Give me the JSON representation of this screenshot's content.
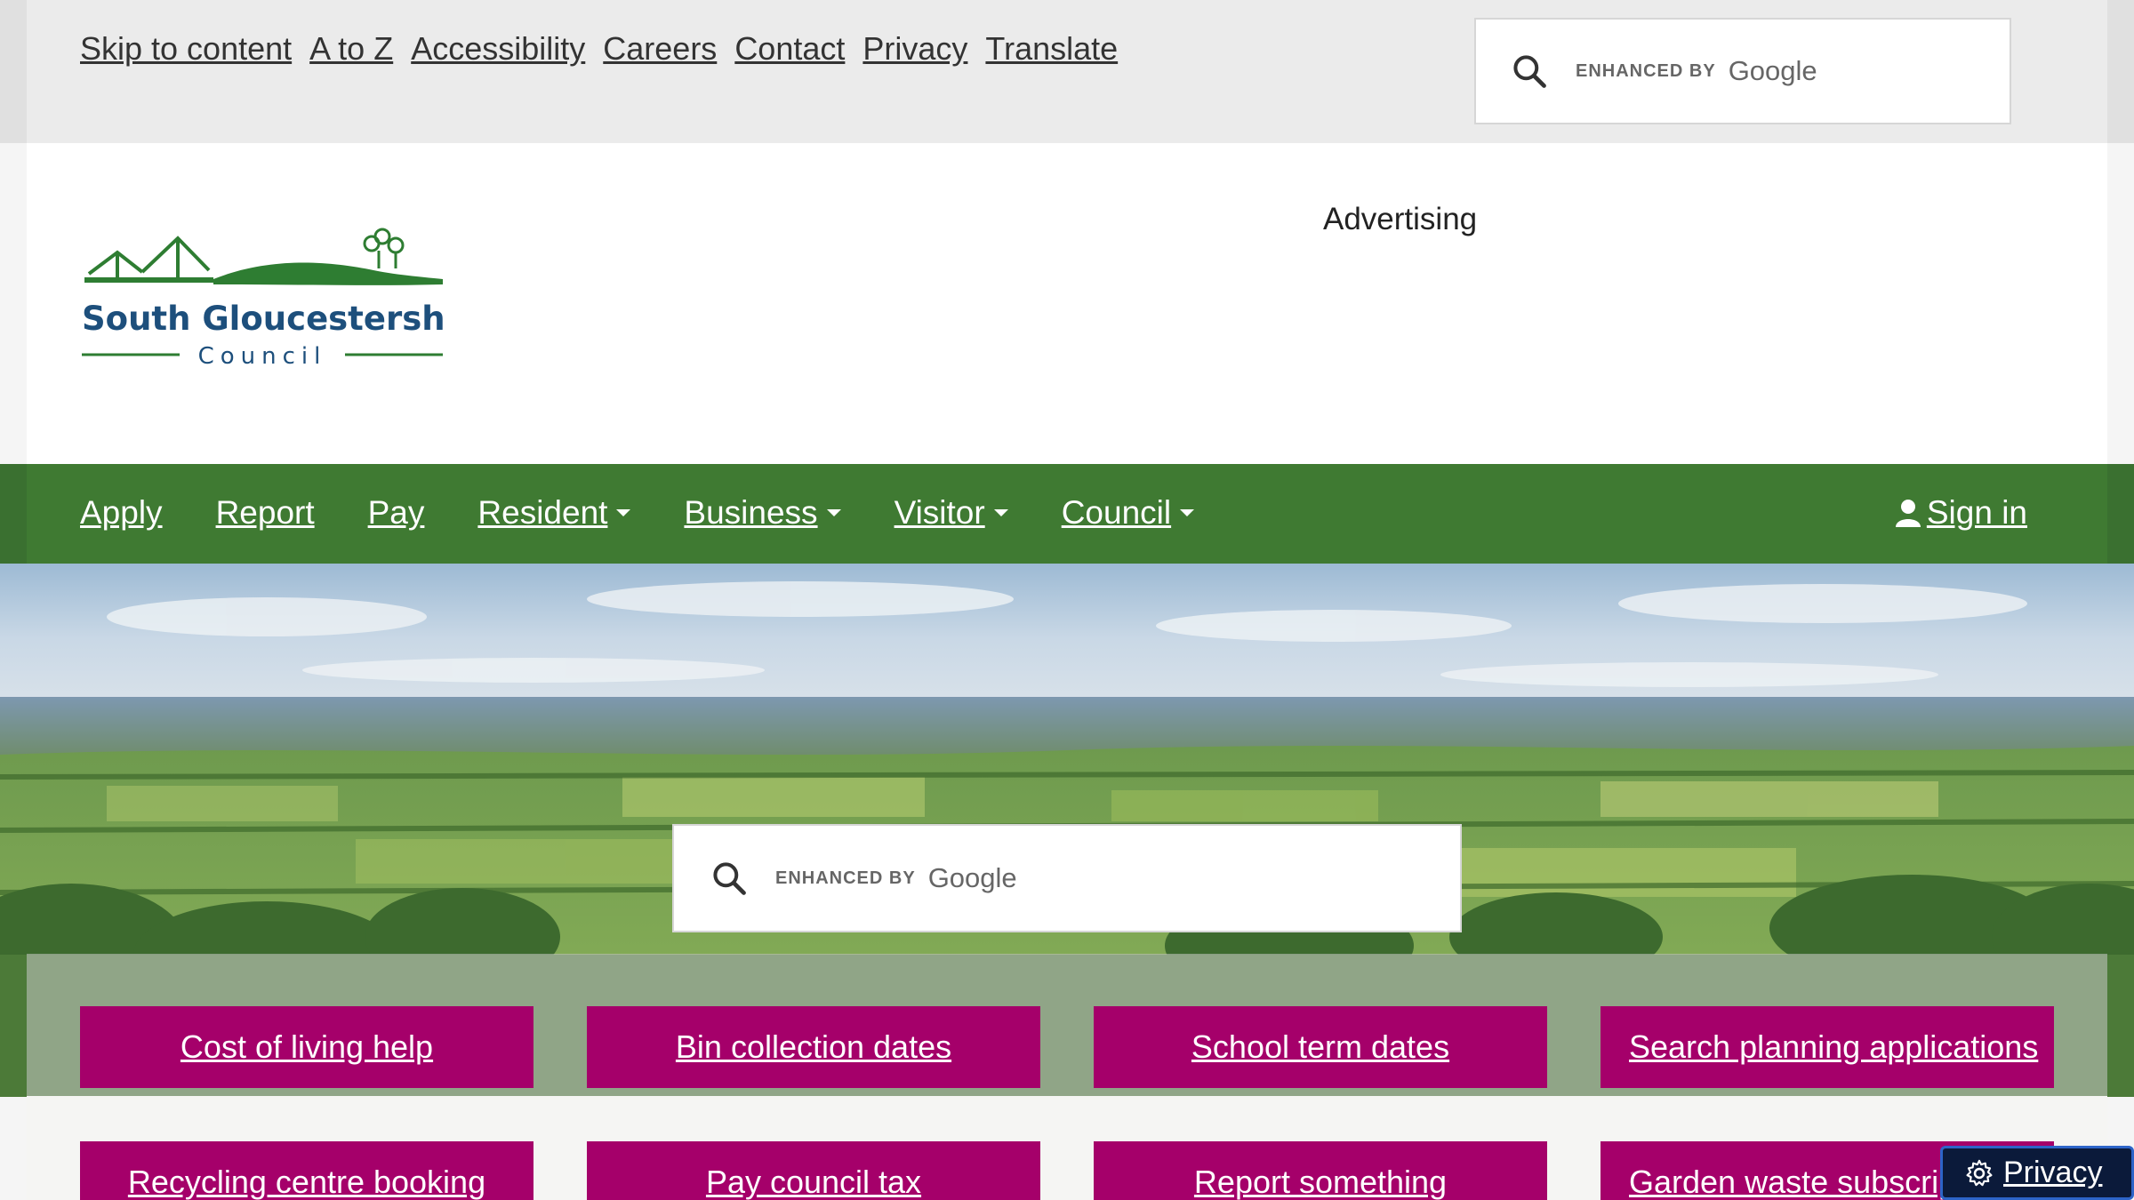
{
  "utility_links": [
    "Skip to content",
    "A to Z",
    "Accessibility",
    "Careers",
    "Contact",
    "Privacy",
    "Translate"
  ],
  "search": {
    "enhanced_by": "ENHANCED BY",
    "provider": "Google"
  },
  "logo": {
    "name_line": "South Gloucestershire",
    "sub_line": "Council"
  },
  "advertising_label": "Advertising",
  "nav": {
    "items": [
      {
        "label": "Apply",
        "dropdown": false
      },
      {
        "label": "Report",
        "dropdown": false
      },
      {
        "label": "Pay",
        "dropdown": false
      },
      {
        "label": "Resident",
        "dropdown": true
      },
      {
        "label": "Business",
        "dropdown": true
      },
      {
        "label": "Visitor",
        "dropdown": true
      },
      {
        "label": "Council",
        "dropdown": true
      }
    ],
    "sign_in": "Sign in"
  },
  "tiles_row1": [
    "Cost of living help",
    "Bin collection dates",
    "School term dates",
    "Search planning applications"
  ],
  "tiles_row2": [
    "Recycling centre booking",
    "Pay council tax",
    "Report something",
    "Garden waste subscription"
  ],
  "privacy_button": "Privacy",
  "colors": {
    "nav_green": "#3f7a32",
    "tile_magenta": "#a5006a",
    "logo_blue": "#1d4f7c",
    "logo_green": "#2e7d32"
  }
}
